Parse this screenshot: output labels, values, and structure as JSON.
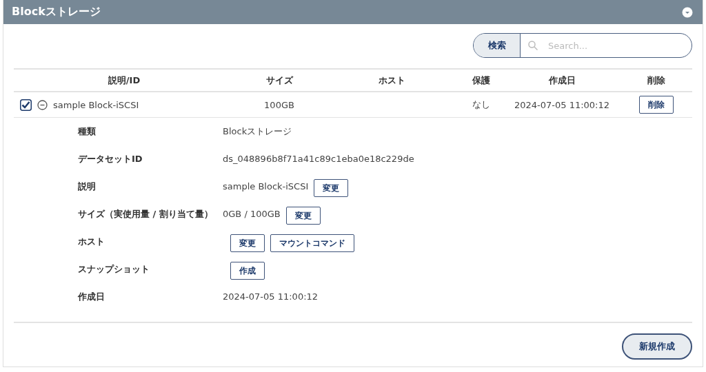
{
  "panel": {
    "title": "Blockストレージ",
    "collapsed": false
  },
  "search": {
    "button": "検索",
    "placeholder": "Search..."
  },
  "table": {
    "columns": [
      "説明/ID",
      "サイズ",
      "ホスト",
      "保護",
      "作成日",
      "削除"
    ],
    "rows": [
      {
        "checked": true,
        "expanded": true,
        "description": "sample Block-iSCSI",
        "size": "100GB",
        "host": "",
        "protection": "なし",
        "created": "2024-07-05 11:00:12",
        "delete_button": "削除"
      }
    ]
  },
  "details": [
    {
      "label": "種類",
      "value": "Blockストレージ"
    },
    {
      "label": "データセットID",
      "value": "ds_048896b8f71a41c89c1eba0e18c229de"
    },
    {
      "label": "説明",
      "value": "sample Block-iSCSI",
      "buttons": [
        "変更"
      ]
    },
    {
      "label": "サイズ（実使用量 / 割り当て量）",
      "value": "0GB / 100GB",
      "buttons": [
        "変更"
      ]
    },
    {
      "label": "ホスト",
      "buttons": [
        "変更",
        "マウントコマンド"
      ]
    },
    {
      "label": "スナップショット",
      "buttons": [
        "作成"
      ]
    },
    {
      "label": "作成日",
      "value": "2024-07-05 11:00:12"
    }
  ],
  "footer": {
    "button": "新規作成"
  }
}
